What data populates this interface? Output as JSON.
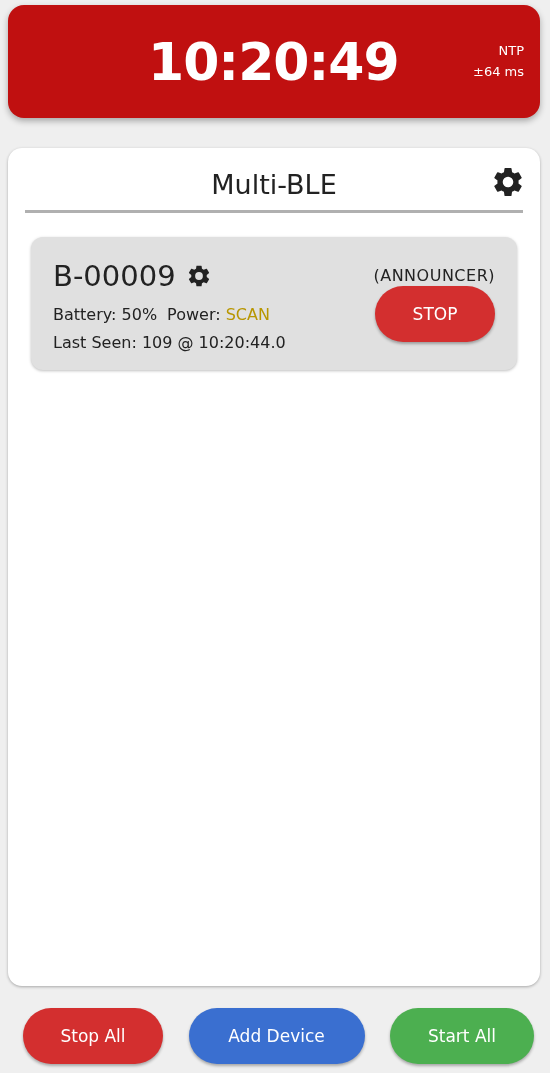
{
  "clock": {
    "time": "10:20:49",
    "source": "NTP",
    "offset": "±64 ms"
  },
  "panel": {
    "title": "Multi-BLE"
  },
  "devices": [
    {
      "name": "B-00009",
      "role": "(ANNOUNCER)",
      "battery": "Battery: 50%",
      "power_label": "Power:",
      "power": "SCAN",
      "last_seen": "Last Seen: 109 @ 10:20:44.0",
      "action": "STOP"
    }
  ],
  "footer_buttons": [
    {
      "kind": "stop",
      "label": "Stop All"
    },
    {
      "kind": "add",
      "label": "Add Device"
    },
    {
      "kind": "start",
      "label": "Start All"
    }
  ]
}
